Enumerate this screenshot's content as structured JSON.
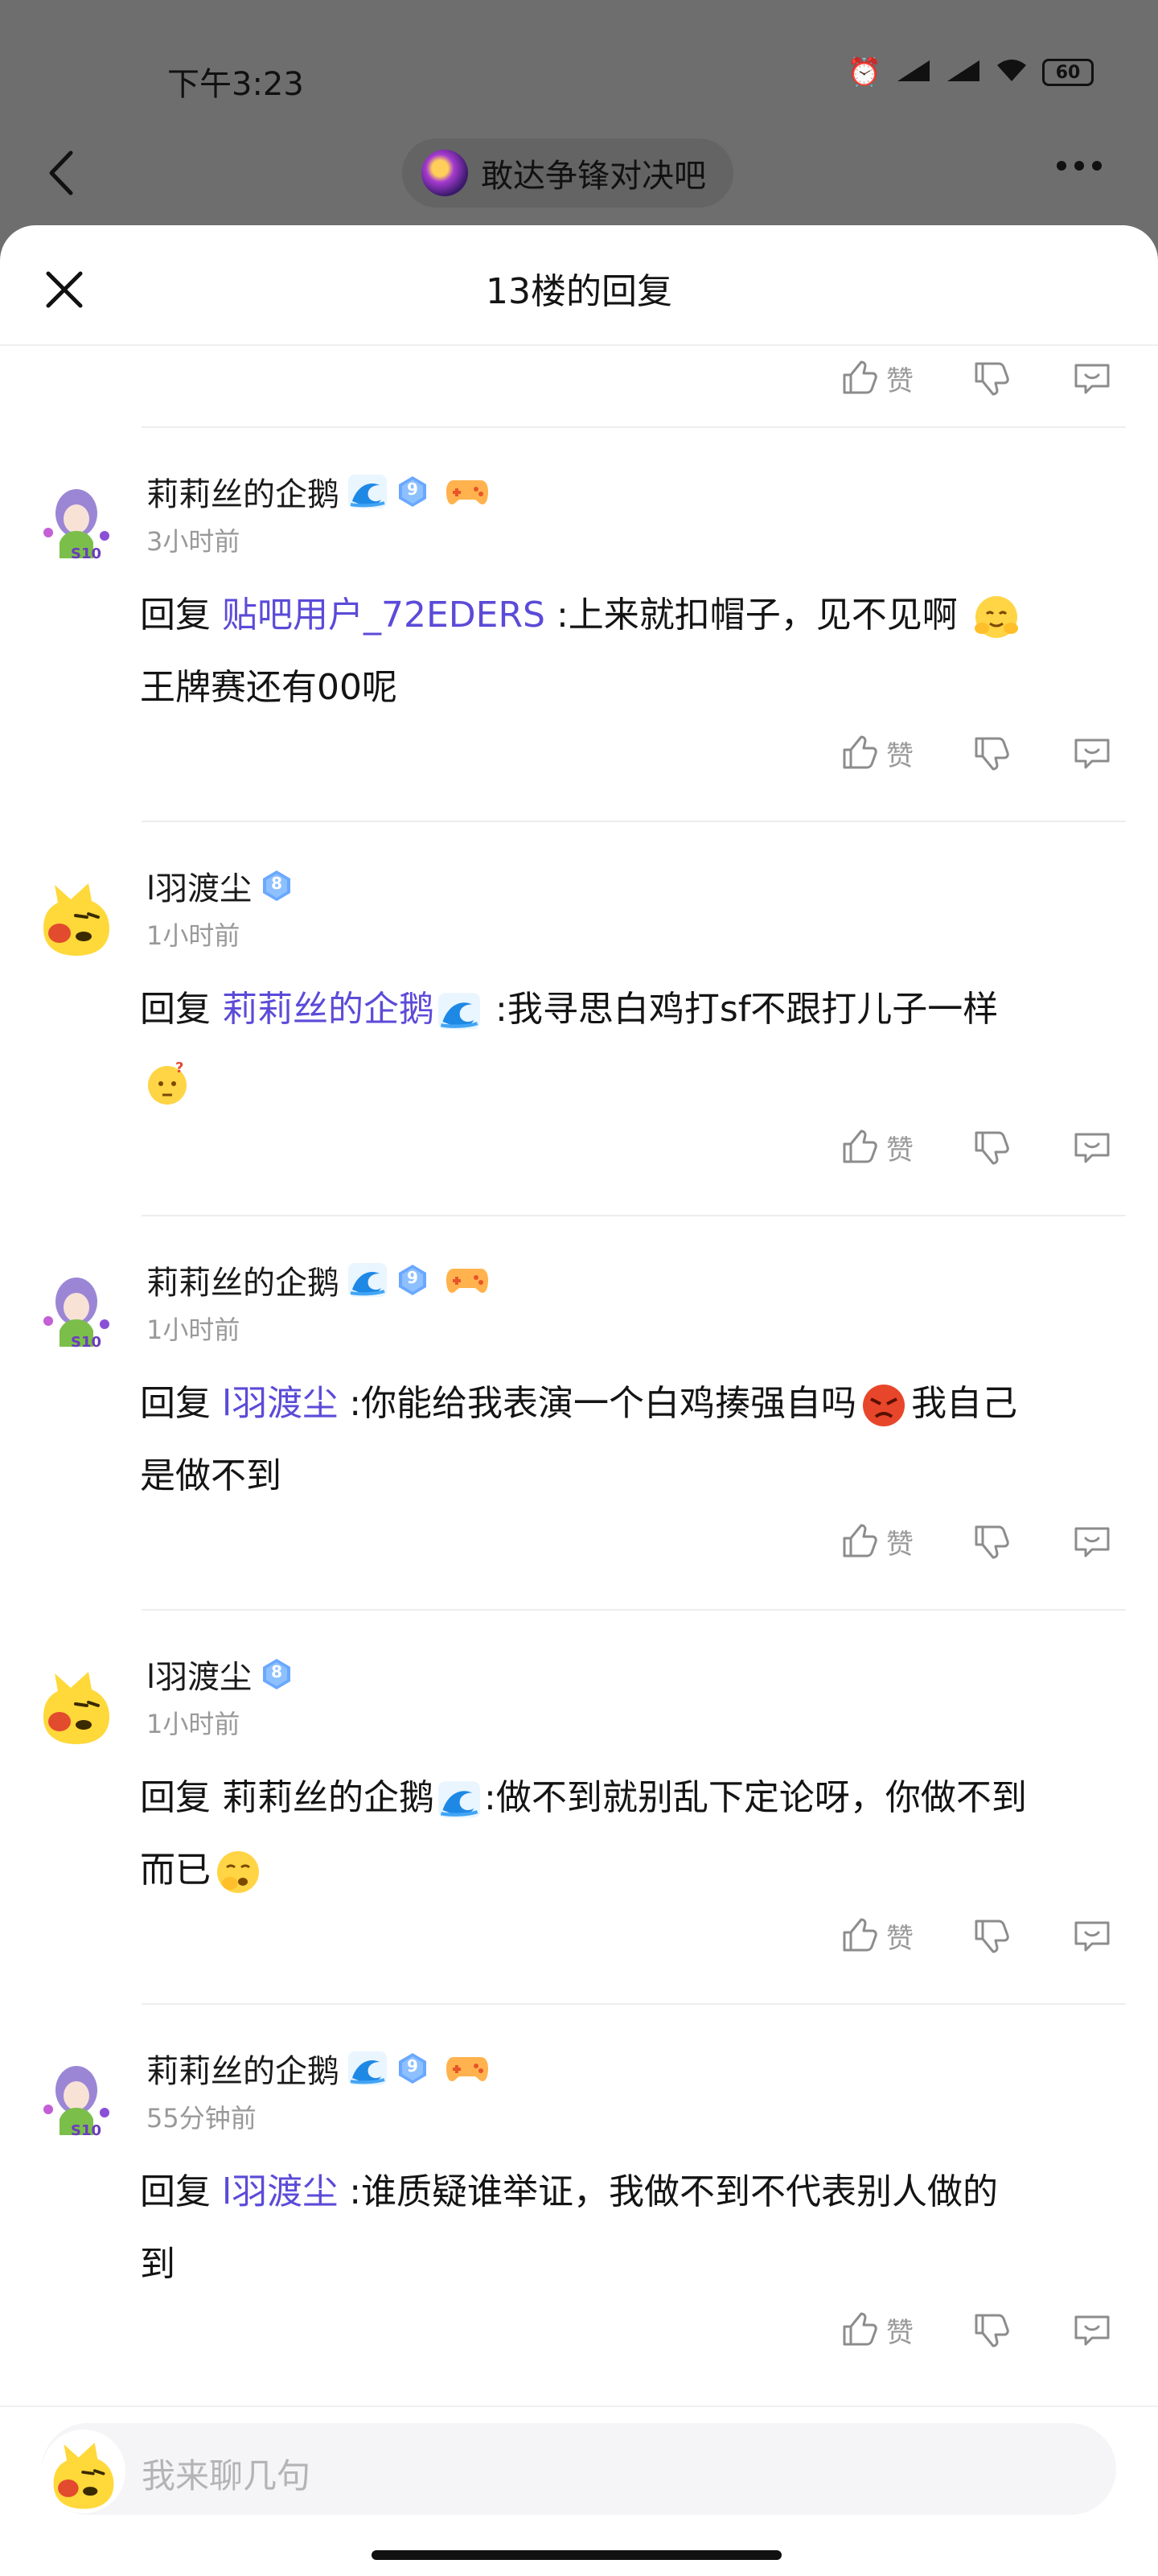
{
  "status_bar": {
    "time": "下午3:23",
    "battery": "60"
  },
  "top_bar": {
    "forum_name": "敢达争锋对决吧"
  },
  "sheet": {
    "title": "13楼的回复"
  },
  "actions": {
    "like_label": "赞"
  },
  "comments": [
    {
      "username": "莉莉丝的企鹅",
      "level": "9",
      "time": "3小时前",
      "reply_prefix": "回复",
      "reply_to": "贴吧用户_72EDERS",
      "text_a": ":上来就扣帽子，见不见啊",
      "text_b": "王牌赛还有00呢",
      "emoji": "hug-emoji"
    },
    {
      "username": "l羽渡尘",
      "level": "8",
      "time": "1小时前",
      "reply_prefix": "回复",
      "reply_to": "莉莉丝的企鹅",
      "text_a": ":我寻思白鸡打sf不跟打儿子一样",
      "emoji": "thinking-emoji"
    },
    {
      "username": "莉莉丝的企鹅",
      "level": "9",
      "time": "1小时前",
      "reply_prefix": "回复",
      "reply_to": "l羽渡尘",
      "text_a": ":你能给我表演一个白鸡揍强自吗",
      "text_b": "我自己",
      "text_c": "是做不到",
      "emoji": "angry-emoji"
    },
    {
      "username": "l羽渡尘",
      "level": "8",
      "time": "1小时前",
      "reply_prefix": "回复",
      "reply_to": "莉莉丝的企鹅",
      "text_a": ":做不到就别乱下定论呀，你做不到",
      "text_b": "而已",
      "emoji": "yawn-emoji"
    },
    {
      "username": "莉莉丝的企鹅",
      "level": "9",
      "time": "55分钟前",
      "reply_prefix": "回复",
      "reply_to": "l羽渡尘",
      "text_a": ":谁质疑谁举证，我做不到不代表别人做的",
      "text_b": "到"
    }
  ],
  "input": {
    "placeholder": "我来聊几句"
  },
  "colors": {
    "mention": "#5b4bd8",
    "badge": "#6aa8ff",
    "muted": "#999999"
  }
}
